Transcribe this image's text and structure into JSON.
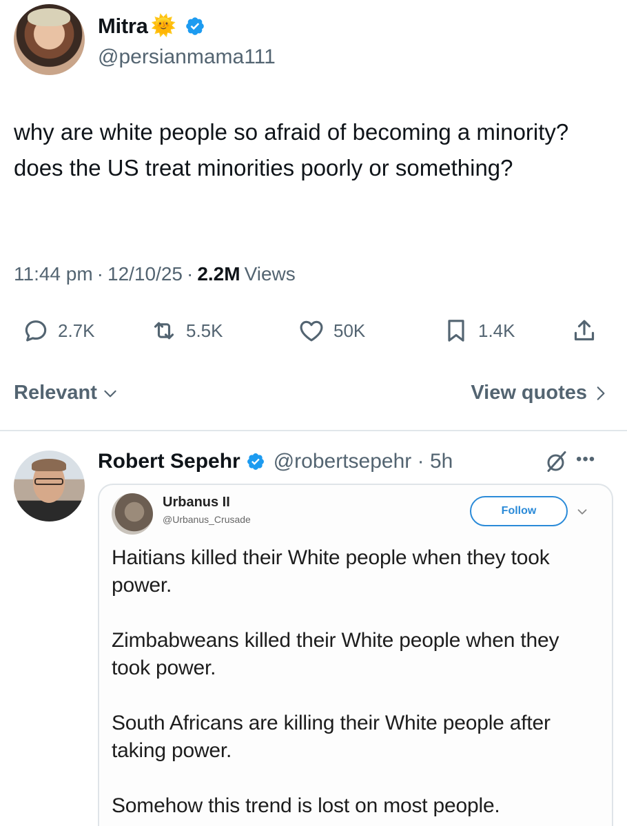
{
  "tweet": {
    "author_name": "Mitra",
    "author_emoji": "🌞",
    "author_handle": "@persianmama111",
    "text": "why are white people so afraid of becoming a minority? does the US treat minorities poorly or something?",
    "time": "11:44 pm",
    "date": "12/10/25",
    "views_count": "2.2M",
    "views_label": "Views",
    "stats": {
      "replies": "2.7K",
      "reposts": "5.5K",
      "likes": "50K",
      "bookmarks": "1.4K"
    }
  },
  "sort": {
    "relevant_label": "Relevant",
    "view_quotes_label": "View quotes"
  },
  "reply": {
    "author_name": "Robert Sepehr",
    "author_handle": "@robertsepehr",
    "time": "5h",
    "embed": {
      "name": "Urbanus II",
      "handle": "@Urbanus_Crusade",
      "follow_label": "Follow",
      "paragraphs": [
        "Haitians killed their White people when they took power.",
        "Zimbabweans killed their White people when they took power.",
        "South Africans are killing their White people after taking power.",
        "Somehow this trend is lost on most people."
      ]
    }
  },
  "colors": {
    "verified_blue": "#1d9bf0",
    "secondary_text": "#536471",
    "follow_blue": "#2a8ad8"
  },
  "icons": [
    "verified-badge-icon",
    "reply-icon",
    "repost-icon",
    "like-icon",
    "bookmark-icon",
    "share-icon",
    "chevron-down-icon",
    "chevron-right-icon",
    "grok-icon",
    "more-icon"
  ]
}
